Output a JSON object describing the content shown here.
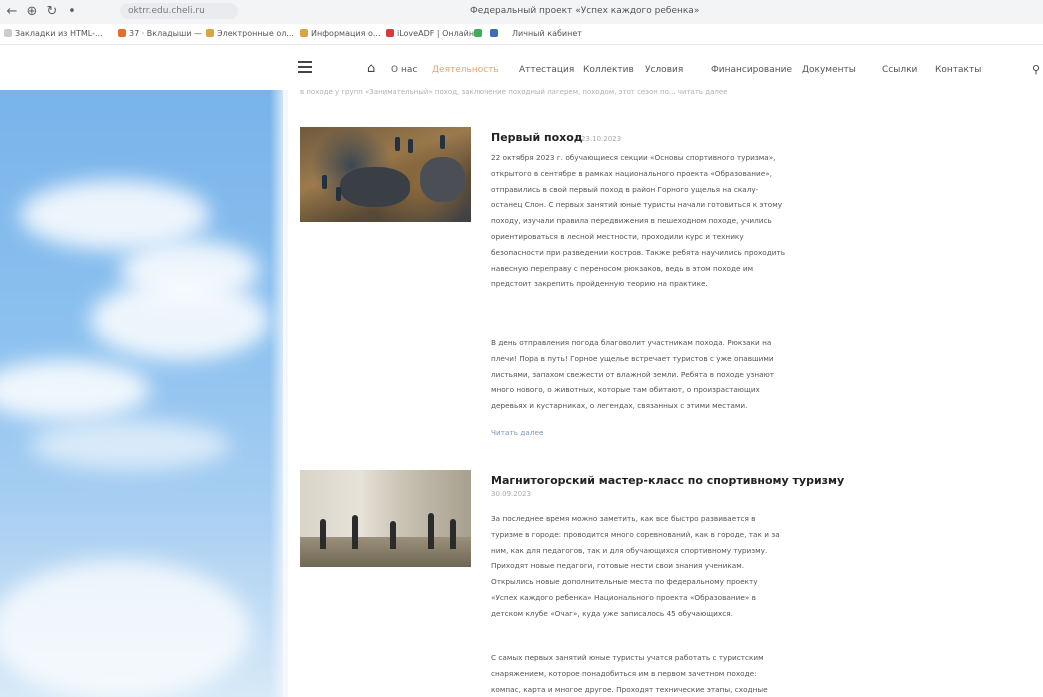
{
  "browser": {
    "url": "oktrr.edu.cheli.ru",
    "tab_title": "Федеральный проект «Успех каждого ребенка»",
    "bookmarks": [
      {
        "label": "Закладки из HTML-...",
        "color": "#cccccc"
      },
      {
        "label": "37 · Вкладыши —",
        "color": "#e2702a"
      },
      {
        "label": "Электронные ол...",
        "color": "#d9a441"
      },
      {
        "label": "Информация о...",
        "color": "#d9a441"
      },
      {
        "label": "iLoveADF | Онлайн",
        "color": "#d63b3b"
      },
      {
        "label": "",
        "color": "#3fae5a"
      },
      {
        "label": "",
        "color": "#3e6db5"
      },
      {
        "label": "Личный кабинет",
        "color": "#ffffff"
      }
    ]
  },
  "site_nav": {
    "items": [
      {
        "label": "О нас",
        "active": false
      },
      {
        "label": "Деятельность",
        "active": true
      },
      {
        "label": "Аттестация",
        "active": false
      },
      {
        "label": "Коллектив",
        "active": false
      },
      {
        "label": "Условия",
        "active": false
      },
      {
        "label": "Финансирование",
        "active": false
      },
      {
        "label": "Документы",
        "active": false
      },
      {
        "label": "Ссылки",
        "active": false
      },
      {
        "label": "Контакты",
        "active": false
      }
    ],
    "active_color": "#f0a07a"
  },
  "top_snippet": "в походе у групп «Занимательный» поход, заключение походный лагерем, походом, этот сезон по... читать далее",
  "posts": [
    {
      "title": "Первый поход",
      "date": "23.10.2023",
      "paragraphs": [
        [
          "22 октября 2023 г. обучающиеся секции «Основы спортивного туризма»,",
          "открытого в сентябре в рамках национального проекта «Образование»,",
          "отправились в свой первый поход в район Горного ущелья на скалу-",
          "останец Слон. С первых занятий юные туристы начали готовиться к этому",
          "походу, изучали правила передвижения в пешеходном походе, учились",
          "ориентироваться в лесной местности, проходили курс и технику",
          "безопасности при разведении костров. Также ребята научились проходить",
          "навесную переправу с переносом рюкзаков, ведь в этом походе им",
          "предстоит закрепить пройденную теорию на практике."
        ],
        [
          "В день отправления погода благоволит участникам похода. Рюкзаки на",
          "плечи! Пора в путь! Горное ущелье встречает туристов с уже опавшими",
          "листьями, запахом свежести от влажной земли. Ребята в походе узнают",
          "много нового, о животных, которые там обитают, о произрастающих",
          "деревьях и кустарниках, о легендах, связанных с этими местами."
        ]
      ],
      "read_more": "Читать далее"
    },
    {
      "title": "Магнитогорский мастер-класс по спортивному туризму",
      "date": "30.09.2023",
      "paragraphs": [
        [
          "За последнее время можно заметить, как все быстро развивается в",
          "туризме в городе: проводится много соревнований, как в городе, так и за",
          "ним, как для педагогов, так и для обучающихся спортивному туризму.",
          "Приходят новые педагоги, готовые нести свои знания ученикам.",
          "Открылись новые дополнительные места по федеральному проекту",
          "«Успех каждого ребенка» Национального проекта «Образование» в",
          "детском клубе «Очаг», куда уже записалось 45 обучающихся."
        ],
        [
          "С самых первых занятий юные туристы учатся работать с туристским",
          "снаряжением, которое понадобиться им в первом зачетном походе:",
          "компас, карта и многое другое. Проходят технические этапы, сходные"
        ]
      ]
    }
  ]
}
